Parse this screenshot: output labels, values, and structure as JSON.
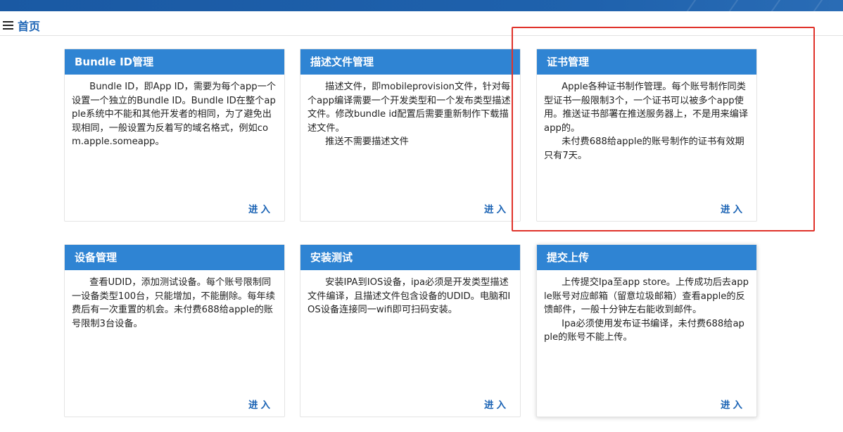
{
  "breadcrumb": {
    "label": "首页"
  },
  "enter_label": "进入",
  "cards": [
    {
      "title": "Bundle ID管理",
      "body": "      Bundle ID，即App ID，需要为每个app一个设置一个独立的Bundle ID。Bundle ID在整个apple系统中不能和其他开发者的相同，为了避免出现相同，一般设置为反着写的域名格式，例如com.apple.someapp。"
    },
    {
      "title": "描述文件管理",
      "body": "      描述文件，即mobileprovision文件，针对每个app编译需要一个开发类型和一个发布类型描述文件。修改bundle id配置后需要重新制作下载描述文件。\n      推送不需要描述文件"
    },
    {
      "title": "证书管理",
      "body": "      Apple各种证书制作管理。每个账号制作同类型证书一般限制3个，一个证书可以被多个app使用。推送证书部署在推送服务器上，不是用来编译app的。\n      未付费688给apple的账号制作的证书有效期只有7天。"
    },
    {
      "title": "设备管理",
      "body": "      查看UDID，添加测试设备。每个账号限制同一设备类型100台，只能增加，不能删除。每年续费后有一次重置的机会。未付费688给apple的账号限制3台设备。"
    },
    {
      "title": "安装测试",
      "body": "      安装IPA到IOS设备，ipa必须是开发类型描述文件编译，且描述文件包含设备的UDID。电脑和IOS设备连接同一wifi即可扫码安装。"
    },
    {
      "title": "提交上传",
      "body": "      上传提交Ipa至app store。上传成功后去apple账号对应邮箱（留意垃圾邮箱）查看apple的反馈邮件，一般十分钟左右能收到邮件。\n      Ipa必须使用发布证书编译，未付费688给apple的账号不能上传。"
    }
  ],
  "colors": {
    "topbar": "#1d5fa8",
    "card_header": "#2f84d3",
    "link": "#1c64b5",
    "highlight_border": "#e0322a"
  }
}
